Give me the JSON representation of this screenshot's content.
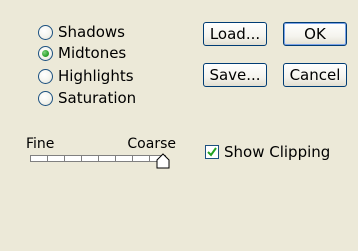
{
  "radios": [
    {
      "label": "Shadows",
      "checked": false
    },
    {
      "label": "Midtones",
      "checked": true
    },
    {
      "label": "Highlights",
      "checked": false
    },
    {
      "label": "Saturation",
      "checked": false
    }
  ],
  "buttons": {
    "load": "Load...",
    "ok": "OK",
    "save": "Save...",
    "cancel": "Cancel"
  },
  "slider": {
    "min_label": "Fine",
    "max_label": "Coarse",
    "value": 1.0
  },
  "show_clipping": {
    "label": "Show Clipping",
    "checked": true
  },
  "colors": {
    "background": "#ece9d8",
    "accent_border": "#003c74",
    "radio_dot": "#2fa52f",
    "check_mark": "#21a121"
  }
}
